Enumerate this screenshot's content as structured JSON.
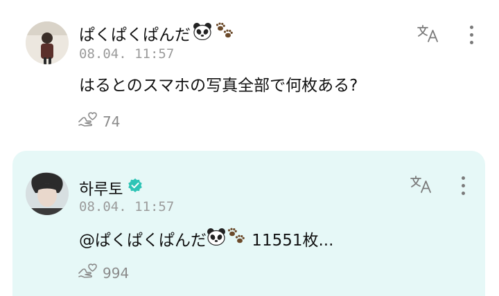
{
  "posts": [
    {
      "author": "ぱくぱくぱんだ",
      "timestamp": "08.04. 11:57",
      "text": "はるとのスマホの写真全部で何枚ある?",
      "likes": "74",
      "verified": false,
      "icons": [
        "panda-emoji",
        "paw-prints-emoji",
        "translate-icon",
        "more-vertical-icon",
        "heart-hand-icon"
      ]
    },
    {
      "author": "하루토",
      "timestamp": "08.04. 11:57",
      "mention": "@ぱくぱくぱんだ",
      "text_suffix": " 11551枚...",
      "likes": "994",
      "verified": true,
      "icons": [
        "verified-badge-icon",
        "panda-emoji",
        "paw-prints-emoji",
        "translate-icon",
        "more-vertical-icon",
        "heart-hand-icon"
      ]
    }
  ],
  "colors": {
    "highlight_background": "#e6f8f7",
    "verified_badge": "#2ec4b6",
    "timestamp_text": "#9a9a9a"
  }
}
